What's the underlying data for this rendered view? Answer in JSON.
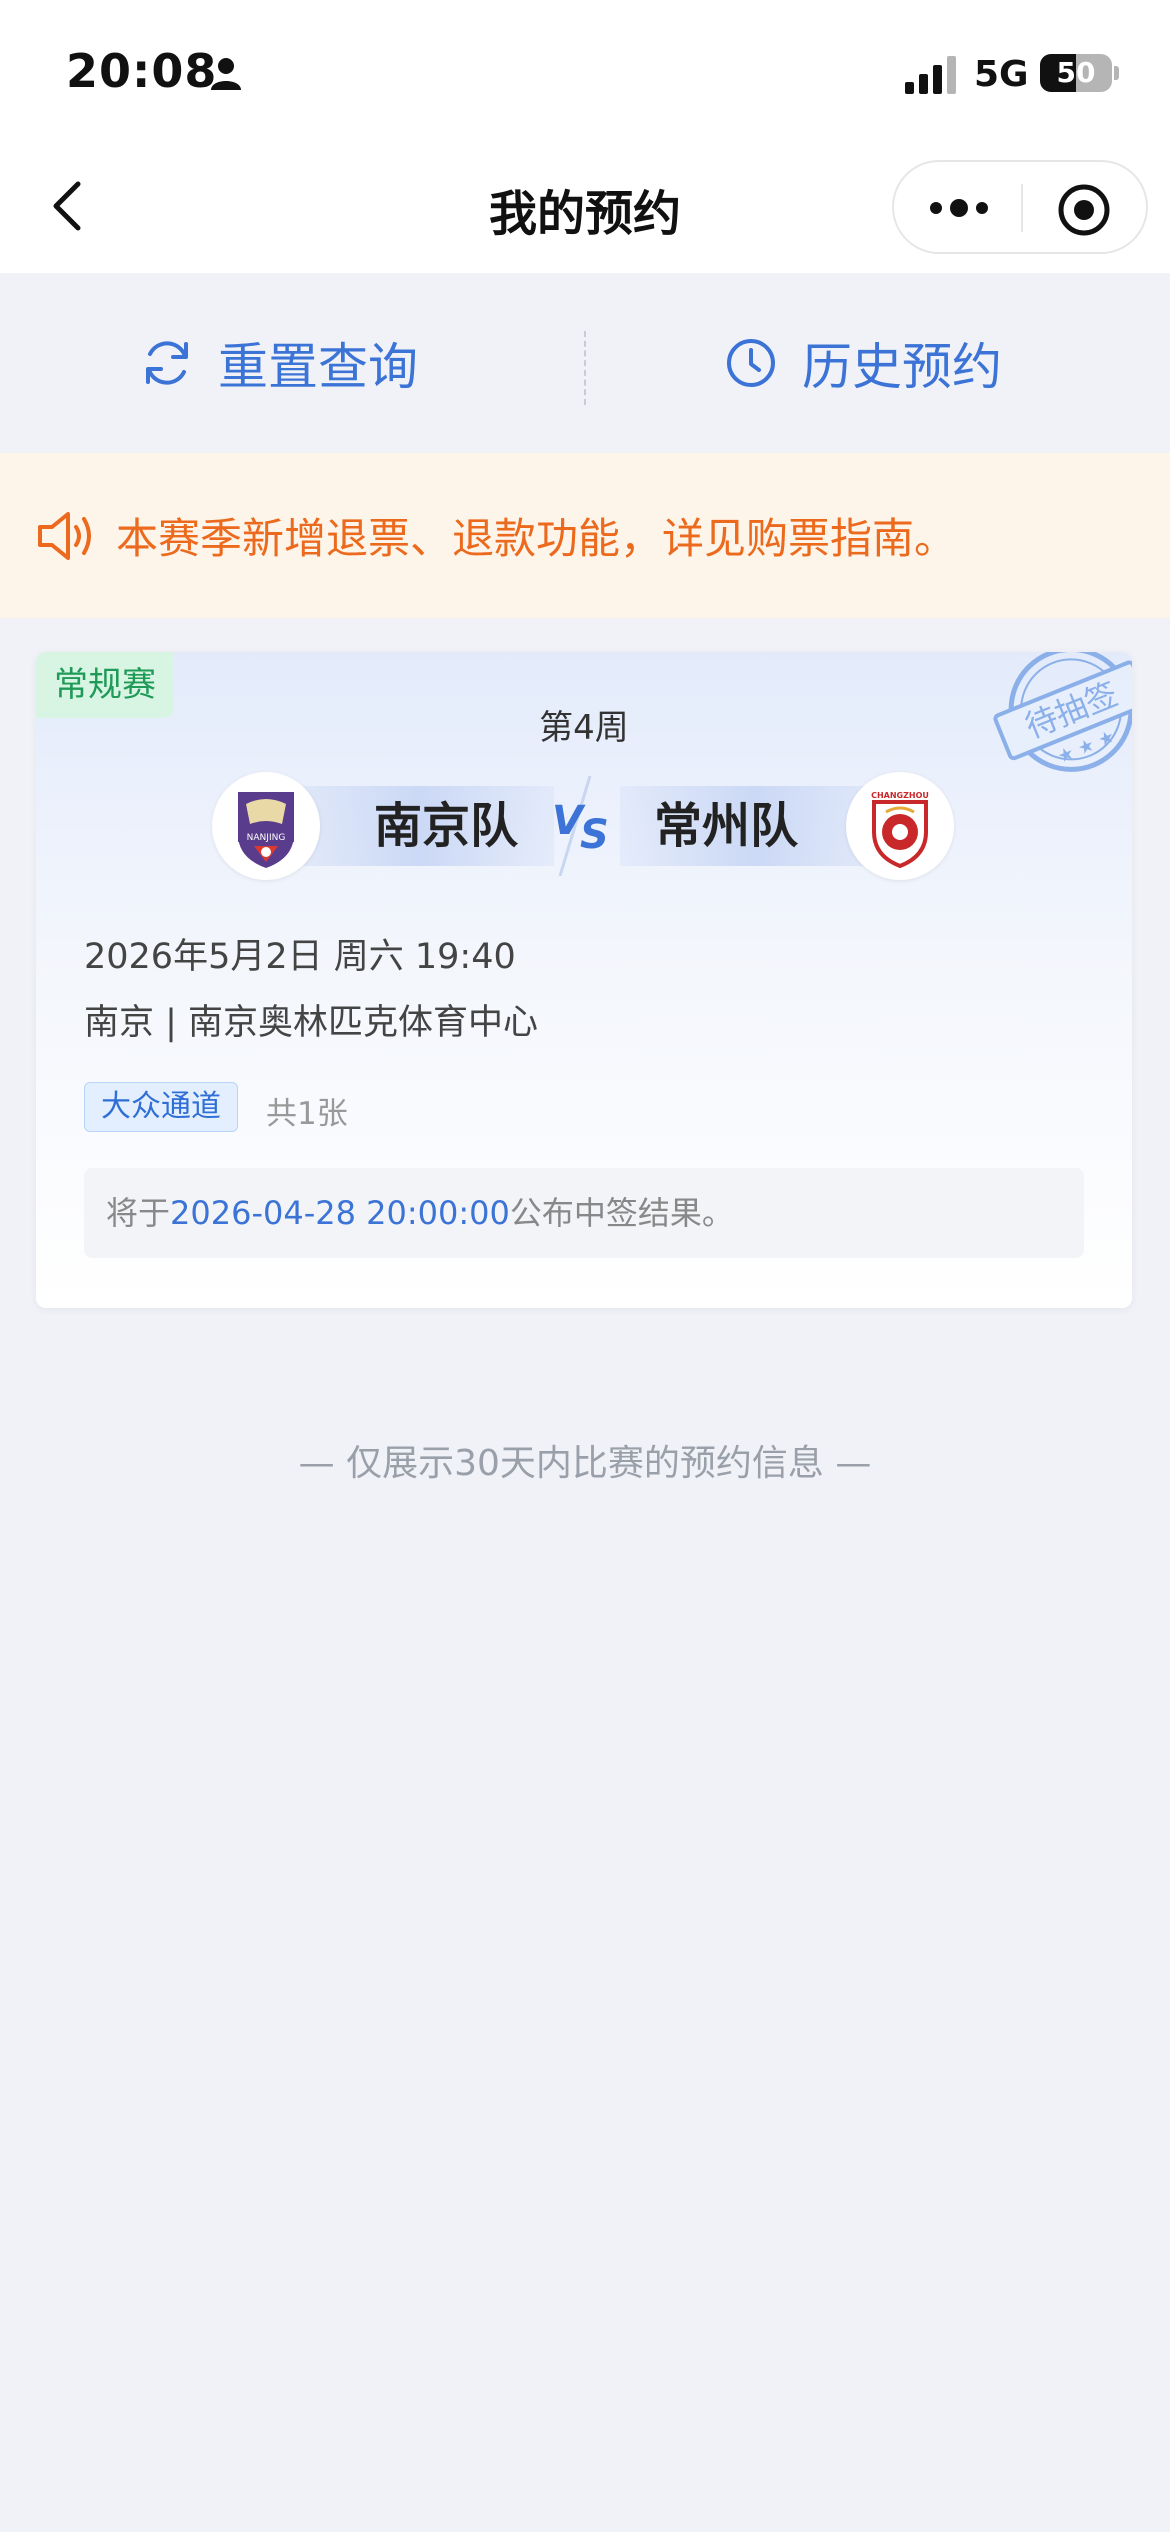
{
  "status_bar": {
    "time": "20:08",
    "network": "5G",
    "battery_level": "50",
    "icons": [
      "person-icon",
      "signal-icon"
    ]
  },
  "nav": {
    "title": "我的预约",
    "icons": [
      "back-chevron-icon",
      "more-dots-icon",
      "target-icon"
    ]
  },
  "actions": {
    "reset_label": "重置查询",
    "history_label": "历史预约"
  },
  "notice": {
    "text": "本赛季新增退票、退款功能，详见购票指南。",
    "icon": "speaker-icon"
  },
  "reservation": {
    "tag": "常规赛",
    "stamp": "待抽签",
    "round": "第4周",
    "home_team": "南京队",
    "away_team": "常州队",
    "home_logo_text": "NANJING",
    "away_logo_text": "CHANGZHOU",
    "datetime": "2026年5月2日 周六 19:40",
    "venue": "南京 | 南京奥林匹克体育中心",
    "channel": "大众通道",
    "ticket_count": "共1张",
    "result_prefix": "将于",
    "result_date": "2026-04-28 20:00:00",
    "result_suffix": "公布中签结果。"
  },
  "footer": {
    "note": "— 仅展示30天内比赛的预约信息 —"
  },
  "colors": {
    "accent_blue": "#3b73d6",
    "notice_orange": "#ec6a1d",
    "tag_green": "#1f9a57",
    "page_bg": "#f0f2f7"
  }
}
